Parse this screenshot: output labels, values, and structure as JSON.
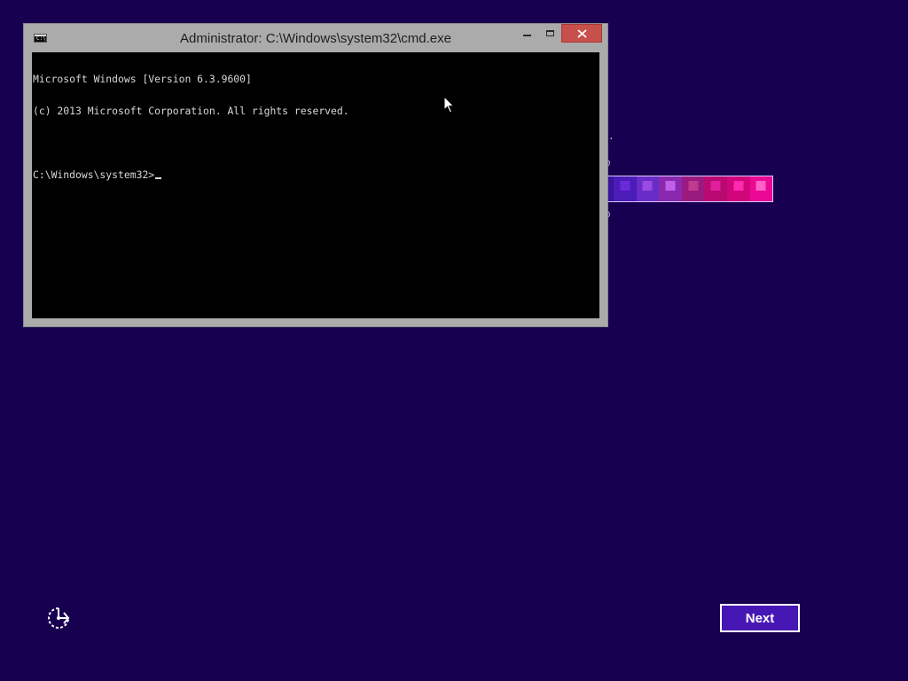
{
  "window": {
    "title": "Administrator: C:\\Windows\\system32\\cmd.exe",
    "icon_text": "C:\\",
    "icon_name": "cmd-app-icon",
    "controls": {
      "minimize_icon": "minimize-icon",
      "maximize_icon": "maximize-icon",
      "close_icon": "close-icon",
      "close_color": "#c7504c"
    }
  },
  "console": {
    "lines": [
      "Microsoft Windows [Version 6.3.9600]",
      "(c) 2013 Microsoft Corporation. All rights reserved.",
      ""
    ],
    "prompt": "C:\\Windows\\system32>",
    "input_value": ""
  },
  "background": {
    "color": "#180050",
    "partial_glyphs": [
      ".",
      "0",
      "0"
    ],
    "strip_colors": [
      "#2a0c86",
      "#3a12a0",
      "#4a1cb8",
      "#6a2cc8",
      "#8a28b0",
      "#9a1a80",
      "#b80a70",
      "#d0067a",
      "#ea0894"
    ],
    "strip_square_colors": [
      "#3a18a8",
      "#5014c0",
      "#6a2ad8",
      "#9a4ae0",
      "#c060e8",
      "#c03a90",
      "#e0209a",
      "#ff2ab0",
      "#ff60c8"
    ]
  },
  "footer": {
    "ease_of_access_icon": "ease-of-access-icon",
    "next_label": "Next"
  },
  "pointer": {
    "icon": "mouse-pointer-icon"
  }
}
